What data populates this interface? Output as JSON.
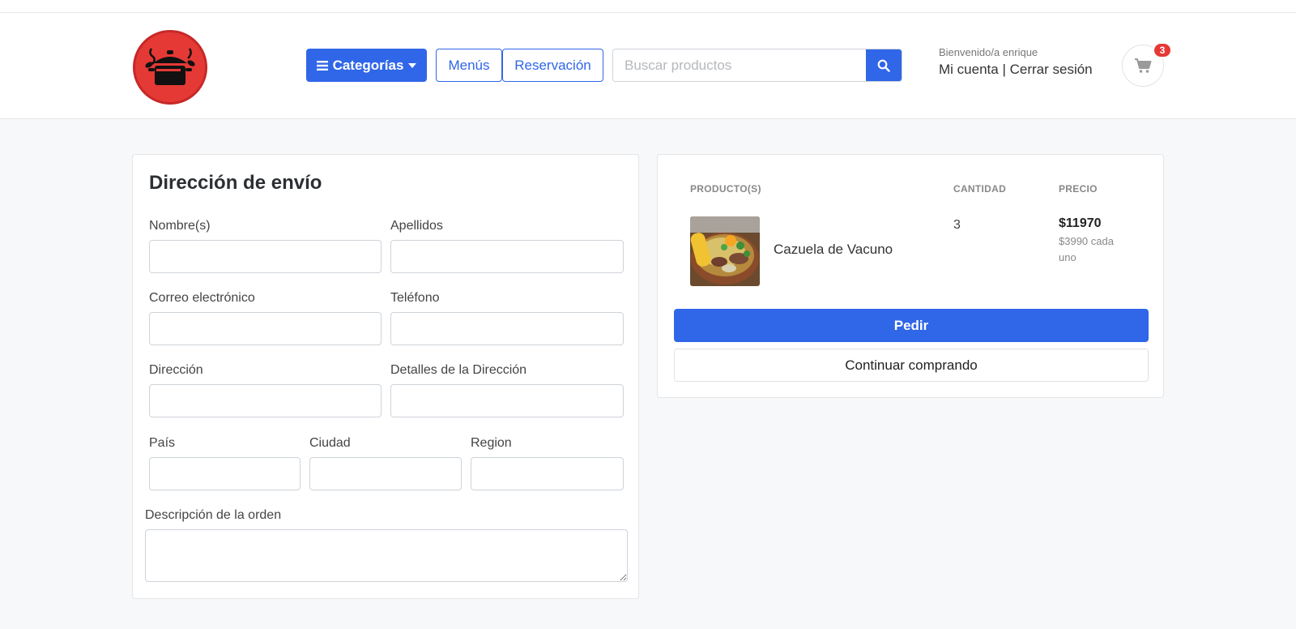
{
  "header": {
    "categories_label": "Categorías",
    "menus_label": "Menús",
    "reservation_label": "Reservación",
    "search_placeholder": "Buscar productos",
    "welcome_text": "Bienvenido/a enrique",
    "my_account_label": "Mi cuenta",
    "separator": "|",
    "logout_label": "Cerrar sesión",
    "cart_count": "3",
    "brand_color": "#3066e8",
    "logo_color": "#e53935"
  },
  "shipping_form": {
    "title": "Dirección de envío",
    "fields": {
      "first_name": "Nombre(s)",
      "last_name": "Apellidos",
      "email": "Correo electrónico",
      "phone": "Teléfono",
      "address": "Dirección",
      "address_details": "Detalles de la Dirección",
      "country": "País",
      "city": "Ciudad",
      "region": "Region",
      "order_description": "Descripción de la orden"
    }
  },
  "order_summary": {
    "col_products": "PRODUCTO(S)",
    "col_quantity": "CANTIDAD",
    "col_price": "PRECIO",
    "items": [
      {
        "name": "Cazuela de Vacuno",
        "quantity": "3",
        "total_price": "$11970",
        "unit_price": "$3990 cada uno"
      }
    ],
    "order_button": "Pedir",
    "continue_button": "Continuar comprando"
  }
}
